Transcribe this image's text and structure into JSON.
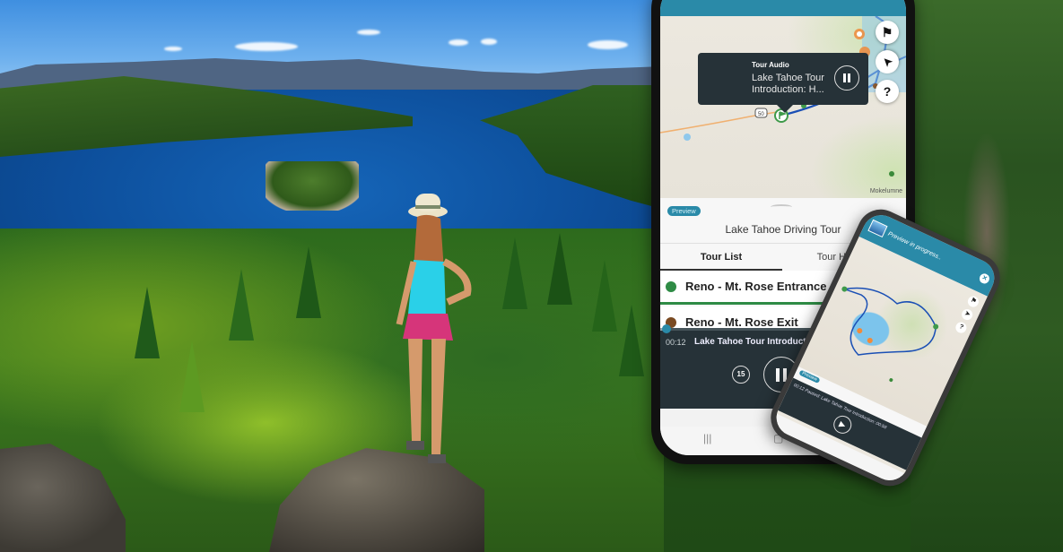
{
  "main_phone": {
    "map": {
      "tooltip": {
        "label": "Tour Audio",
        "title": "Lake Tahoe Tour Introduction: H...",
        "pause_icon": "pause-icon"
      },
      "buttons": [
        {
          "icon": "flag-icon",
          "glyph": "⚑"
        },
        {
          "icon": "location-arrow-icon",
          "glyph": "➤"
        },
        {
          "icon": "help-icon",
          "glyph": "?"
        }
      ],
      "route_label": "50",
      "place_label": "Mokelumne"
    },
    "sheet": {
      "badge": "Preview",
      "title": "Lake Tahoe Driving Tour",
      "tabs": [
        {
          "label": "Tour List",
          "active": true
        },
        {
          "label": "Tour Highlights",
          "active": false
        }
      ],
      "stops": [
        {
          "label": "Reno - Mt. Rose Entrance",
          "color": "#2e8b45"
        },
        {
          "label": "Reno - Mt. Rose Exit",
          "color": "#7a4a22"
        }
      ]
    },
    "player": {
      "time": "00:12",
      "track": "Lake Tahoe Tour Introduction",
      "rewind_seconds": "15",
      "progress": 0.02
    },
    "nav": {
      "recent": "|||",
      "home": "▢"
    }
  },
  "second_phone": {
    "title": "Preview in progress..",
    "close": "✕",
    "badge": "Preview",
    "track": "00:12  Paused: Lake Tahoe Tour Introduction:  00:58",
    "play": "▶",
    "buttons": [
      "⚑",
      "➤",
      "?"
    ]
  },
  "colors": {
    "brand_teal": "#2a8aa8",
    "player_dark": "#263238",
    "stop_green": "#2e8b45",
    "stop_brown": "#7a4a22"
  }
}
